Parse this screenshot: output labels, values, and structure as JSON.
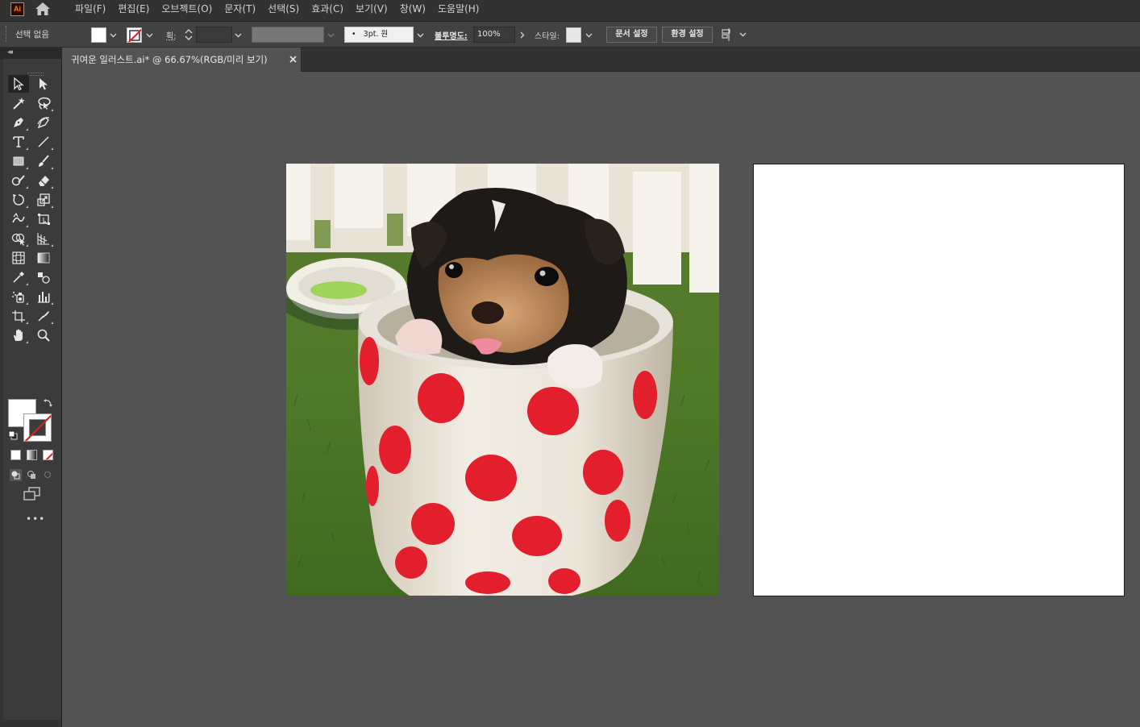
{
  "app": {
    "logo_text": "Ai",
    "menu": [
      "파일(F)",
      "편집(E)",
      "오브젝트(O)",
      "문자(T)",
      "선택(S)",
      "효과(C)",
      "보기(V)",
      "창(W)",
      "도움말(H)"
    ]
  },
  "controlbar": {
    "selection_label": "선택 없음",
    "stroke_label": "획:",
    "brush_value": "•   3pt. 원",
    "opacity_label": "불투명도:",
    "opacity_value": "100%",
    "style_label": "스타일:",
    "document_setup_button": "문서 설정",
    "preferences_button": "환경 설정"
  },
  "document_tab": {
    "title": "귀여운 일러스트.ai* @ 66.67%(RGB/미리 보기)",
    "close_glyph": "×"
  },
  "toolbar": {
    "more_glyph": "•••",
    "tools": [
      "selection-tool",
      "direct-selection-tool",
      "magic-wand-tool",
      "lasso-tool",
      "pen-tool",
      "curvature-tool",
      "type-tool",
      "line-segment-tool",
      "rectangle-tool",
      "paintbrush-tool",
      "shaper-tool",
      "eraser-tool",
      "rotate-tool",
      "scale-tool",
      "width-tool",
      "free-transform-tool",
      "shape-builder-tool",
      "perspective-grid-tool",
      "mesh-tool",
      "gradient-tool",
      "eyedropper-tool",
      "blend-tool",
      "symbol-sprayer-tool",
      "column-graph-tool",
      "artboard-tool",
      "slice-tool",
      "hand-tool",
      "zoom-tool"
    ]
  },
  "colors": {
    "fill": "#ffffff",
    "stroke": "none",
    "accent_none_slash": "#e01b24",
    "canvas_bg": "#535353",
    "panel_bg": "#323232"
  },
  "canvas": {
    "placed_image": "puppy-in-polka-dot-cup-photo",
    "artboard": "blank-white-artboard"
  }
}
